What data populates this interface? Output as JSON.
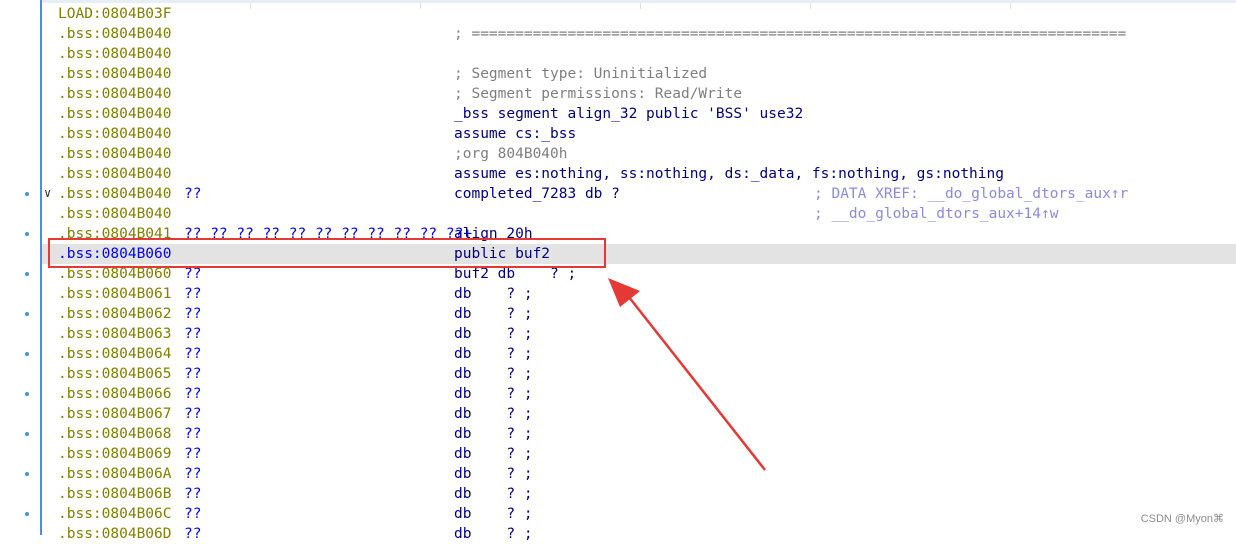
{
  "listing": {
    "rows": [
      {
        "addr": "LOAD:0804B03F",
        "bytes": "",
        "instr": "",
        "comment": "",
        "xref": ""
      },
      {
        "addr": ".bss:0804B040",
        "bytes": "",
        "instr": "",
        "comment": "; ===========================================================================",
        "xref": ""
      },
      {
        "addr": ".bss:0804B040",
        "bytes": "",
        "instr": "",
        "comment": "",
        "xref": ""
      },
      {
        "addr": ".bss:0804B040",
        "bytes": "",
        "instr": "",
        "comment": "; Segment type: Uninitialized",
        "xref": ""
      },
      {
        "addr": ".bss:0804B040",
        "bytes": "",
        "instr": "",
        "comment": "; Segment permissions: Read/Write",
        "xref": ""
      },
      {
        "addr": ".bss:0804B040",
        "bytes": "",
        "instr": "_bss segment align_32 public 'BSS' use32",
        "comment": "",
        "xref": ""
      },
      {
        "addr": ".bss:0804B040",
        "bytes": "",
        "instr": "assume cs:_bss",
        "comment": "",
        "xref": ""
      },
      {
        "addr": ".bss:0804B040",
        "bytes": "",
        "instr": "",
        "comment": ";org 804B040h",
        "xref": ""
      },
      {
        "addr": ".bss:0804B040",
        "bytes": "",
        "instr": "assume es:nothing, ss:nothing, ds:_data, fs:nothing, gs:nothing",
        "comment": "",
        "xref": ""
      },
      {
        "addr": ".bss:0804B040",
        "bytes": "??",
        "instr": "completed_7283 db ?",
        "comment": "",
        "xref": "; DATA XREF: __do_global_dtors_aux↑r"
      },
      {
        "addr": ".bss:0804B040",
        "bytes": "",
        "instr": "",
        "comment": "",
        "xref": "; __do_global_dtors_aux+14↑w"
      },
      {
        "addr": ".bss:0804B041",
        "bytes": "?? ?? ?? ?? ?? ?? ?? ?? ?? ?? ??+",
        "instr": "align 20h",
        "comment": "",
        "xref": ""
      },
      {
        "addr": ".bss:0804B060",
        "bytes": "",
        "instr": "public buf2",
        "comment": "",
        "xref": ""
      },
      {
        "addr": ".bss:0804B060",
        "bytes": "??",
        "instr": "buf2 db    ? ;",
        "comment": "",
        "xref": ""
      },
      {
        "addr": ".bss:0804B061",
        "bytes": "??",
        "instr": "db    ? ;",
        "comment": "",
        "xref": ""
      },
      {
        "addr": ".bss:0804B062",
        "bytes": "??",
        "instr": "db    ? ;",
        "comment": "",
        "xref": ""
      },
      {
        "addr": ".bss:0804B063",
        "bytes": "??",
        "instr": "db    ? ;",
        "comment": "",
        "xref": ""
      },
      {
        "addr": ".bss:0804B064",
        "bytes": "??",
        "instr": "db    ? ;",
        "comment": "",
        "xref": ""
      },
      {
        "addr": ".bss:0804B065",
        "bytes": "??",
        "instr": "db    ? ;",
        "comment": "",
        "xref": ""
      },
      {
        "addr": ".bss:0804B066",
        "bytes": "??",
        "instr": "db    ? ;",
        "comment": "",
        "xref": ""
      },
      {
        "addr": ".bss:0804B067",
        "bytes": "??",
        "instr": "db    ? ;",
        "comment": "",
        "xref": ""
      },
      {
        "addr": ".bss:0804B068",
        "bytes": "??",
        "instr": "db    ? ;",
        "comment": "",
        "xref": ""
      },
      {
        "addr": ".bss:0804B069",
        "bytes": "??",
        "instr": "db    ? ;",
        "comment": "",
        "xref": ""
      },
      {
        "addr": ".bss:0804B06A",
        "bytes": "??",
        "instr": "db    ? ;",
        "comment": "",
        "xref": ""
      },
      {
        "addr": ".bss:0804B06B",
        "bytes": "??",
        "instr": "db    ? ;",
        "comment": "",
        "xref": ""
      },
      {
        "addr": ".bss:0804B06C",
        "bytes": "??",
        "instr": "db    ? ;",
        "comment": "",
        "xref": ""
      },
      {
        "addr": ".bss:0804B06D",
        "bytes": "??",
        "instr": "db    ? ;",
        "comment": "",
        "xref": ""
      }
    ],
    "current_row_index": 12
  },
  "annotation": {
    "box_color": "#e53935",
    "arrow_color": "#e53935"
  },
  "watermark": "CSDN @Myon⌘"
}
